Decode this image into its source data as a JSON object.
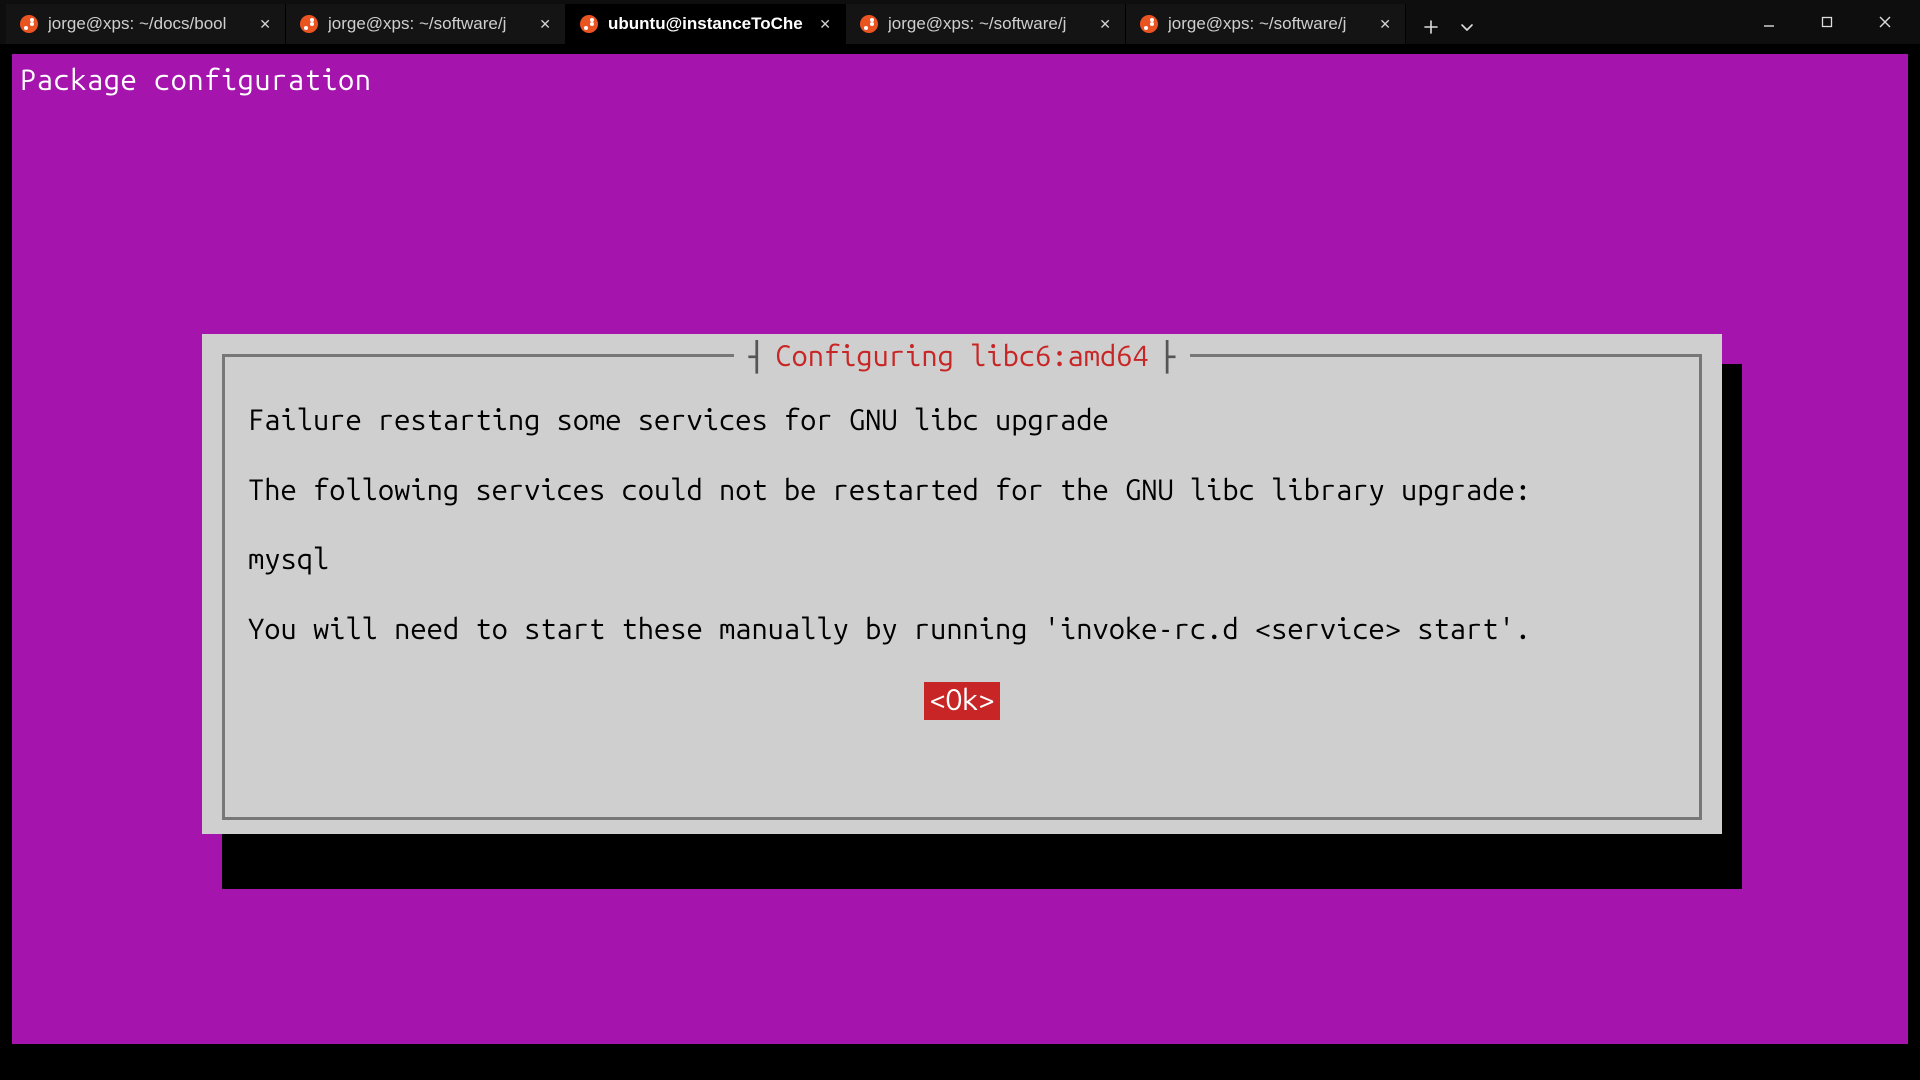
{
  "tabs": [
    {
      "title": "jorge@xps: ~/docs/bool",
      "active": false
    },
    {
      "title": "jorge@xps: ~/software/j",
      "active": false
    },
    {
      "title": "ubuntu@instanceToChe",
      "active": true
    },
    {
      "title": "jorge@xps: ~/software/j",
      "active": false
    },
    {
      "title": "jorge@xps: ~/software/j",
      "active": false
    }
  ],
  "terminal": {
    "header": "Package configuration"
  },
  "dialog": {
    "title": "Configuring libc6:amd64",
    "lines": [
      "Failure restarting some services for GNU libc upgrade",
      "The following services could not be restarted for the GNU libc library upgrade:",
      "mysql",
      "You will need to start these manually by running 'invoke-rc.d <service> start'."
    ],
    "ok_label": "<Ok>"
  },
  "colors": {
    "terminal_bg": "#a515ae",
    "dialog_bg": "#cfcfcf",
    "accent_red": "#c82626",
    "ubuntu_orange": "#e95420"
  }
}
